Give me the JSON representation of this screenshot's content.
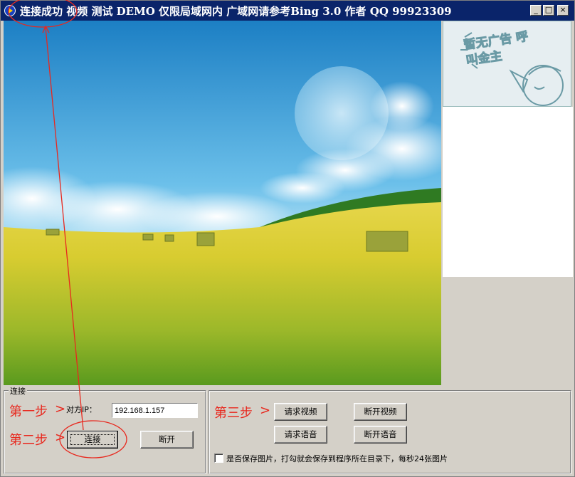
{
  "window": {
    "title": "连接成功 视频 测试 DEMO 仅限局域网内 广域网请参考Bing 3.0 作者 QQ 99923309",
    "minimize_glyph": "_",
    "maximize_glyph": "□",
    "close_glyph": "×"
  },
  "ad": {
    "text": "暂无广告 呼叫金主"
  },
  "connect_group": {
    "label": "连接",
    "step1": "第一步",
    "step2": "第二步",
    "ip_label": "对方IP：",
    "ip_value": "192.168.1.157",
    "connect_button": "连接",
    "disconnect_button": "断开"
  },
  "media_group": {
    "step3": "第三步",
    "request_video": "请求视频",
    "disconnect_video": "断开视频",
    "request_audio": "请求语音",
    "disconnect_audio": "断开语音",
    "save_checkbox_label": "是否保存图片，打勾就会保存到程序所在目录下，每秒24张图片",
    "save_checked": false
  },
  "colors": {
    "titlebar": "#0a246a",
    "annotation_red": "#e8281e",
    "face": "#d4d0c8"
  }
}
